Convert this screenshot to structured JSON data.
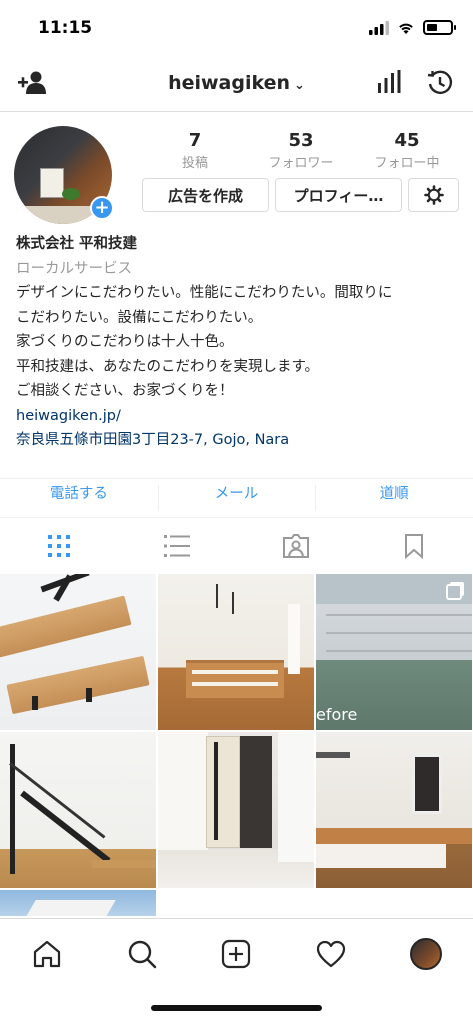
{
  "status": {
    "time": "11:15"
  },
  "nav": {
    "username": "heiwagiken",
    "chevron": "⌄"
  },
  "profile": {
    "stats": [
      {
        "num": "7",
        "label": "投稿"
      },
      {
        "num": "53",
        "label": "フォロワー"
      },
      {
        "num": "45",
        "label": "フォロー中"
      }
    ],
    "buttons": {
      "ad": "広告を作成",
      "profile": "プロフィー…"
    },
    "name": "株式会社 平和技建",
    "category": "ローカルサービス",
    "bio": "デザインにこだわりたい。性能にこだわりたい。間取りに\nこだわりたい。設備にこだわりたい。\n家づくりのこだわりは十人十色。\n平和技建は、あなたのこだわりを実現します。\nご相談ください、お家づくりを！",
    "link": "heiwagiken.jp/",
    "address": "奈良県五條市田園3丁目23-7, Gojo, Nara"
  },
  "contact": {
    "call": "電話する",
    "email": "メール",
    "directions": "道順"
  },
  "grid": {
    "before_text": "efore"
  },
  "colors": {
    "accent": "#3897f0",
    "link": "#003569",
    "muted": "#999999"
  },
  "icons": {
    "add_user": "add-user-icon",
    "insights": "insights-icon",
    "archive": "archive-icon",
    "settings": "gear-icon"
  }
}
